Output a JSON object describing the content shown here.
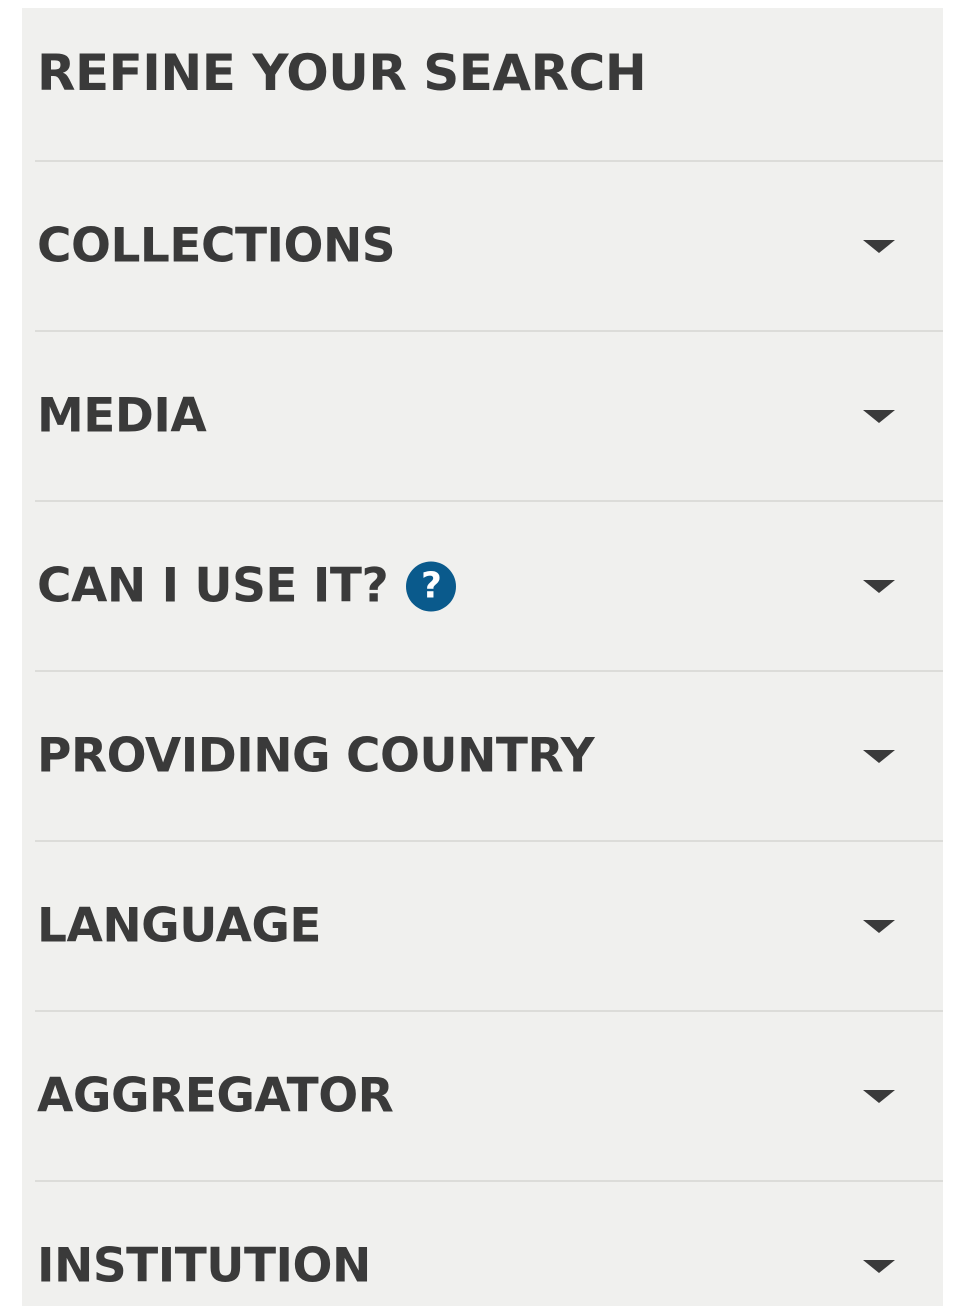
{
  "sidebar": {
    "title": "REFINE YOUR SEARCH",
    "facets": [
      {
        "label": "COLLECTIONS"
      },
      {
        "label": "MEDIA"
      },
      {
        "label": "CAN I USE IT?",
        "help_icon": "help-question-icon",
        "help_glyph": "?"
      },
      {
        "label": "PROVIDING COUNTRY"
      },
      {
        "label": "LANGUAGE"
      },
      {
        "label": "AGGREGATOR"
      },
      {
        "label": "INSTITUTION"
      }
    ]
  },
  "colors": {
    "panel_background": "#f0f0ee",
    "text": "#3a3a3a",
    "divider": "#dcdcd9",
    "help_icon": "#0a5a8c"
  },
  "icons": {
    "expand": "chevron-down-icon"
  }
}
